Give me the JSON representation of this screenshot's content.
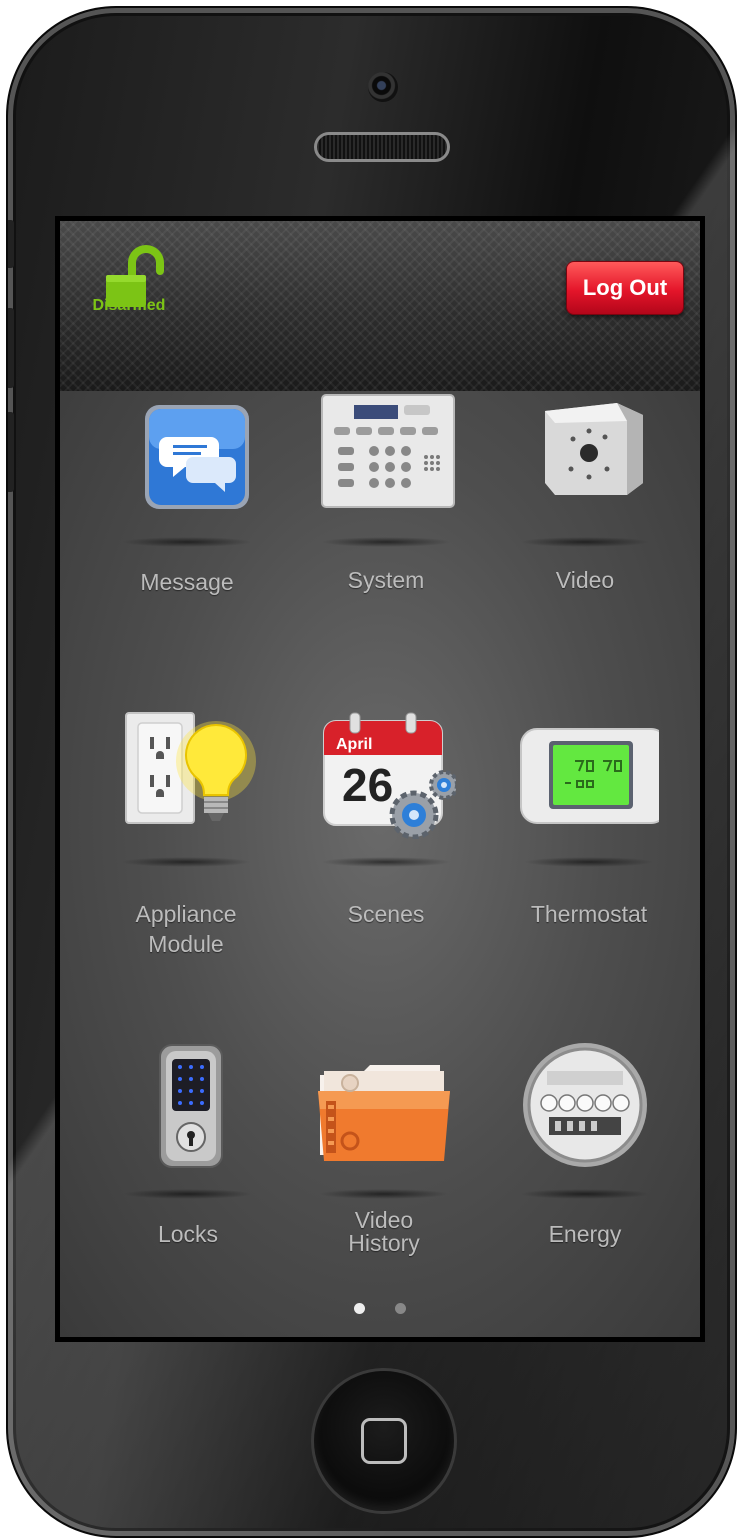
{
  "status": {
    "label": "Disarmed",
    "color": "#7cc415"
  },
  "header": {
    "logout_label": "Log Out",
    "logout_color": "#e4152a"
  },
  "tiles": [
    {
      "label": "Message",
      "icon": "message-icon"
    },
    {
      "label": "System",
      "icon": "security-panel-icon"
    },
    {
      "label": "Video",
      "icon": "camera-icon"
    },
    {
      "label": "Appliance Module",
      "icon": "appliance-outlet-bulb-icon"
    },
    {
      "label": "Scenes",
      "icon": "calendar-gears-icon"
    },
    {
      "label": "Thermostat",
      "icon": "thermostat-icon"
    },
    {
      "label": "Locks",
      "icon": "keypad-lock-icon"
    },
    {
      "label": "Video History",
      "icon": "video-folder-icon"
    },
    {
      "label": "Energy",
      "icon": "energy-meter-icon"
    }
  ],
  "calendar": {
    "month": "April",
    "day": "26"
  },
  "pager": {
    "current_page": 1,
    "total_pages": 2
  }
}
